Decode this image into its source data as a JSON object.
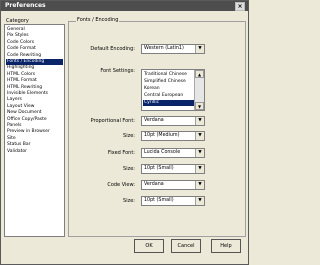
{
  "window": {
    "title": "Preferences",
    "close_glyph": "×"
  },
  "sidebar": {
    "label": "Category",
    "items": [
      {
        "label": "General"
      },
      {
        "label": "Pix Styles"
      },
      {
        "label": "Code Colors"
      },
      {
        "label": "Code Format"
      },
      {
        "label": "Code Rewriting"
      },
      {
        "label": "Fonts / Encoding",
        "selected": true
      },
      {
        "label": "Highlighting"
      },
      {
        "label": "HTML Colors"
      },
      {
        "label": "HTML Format"
      },
      {
        "label": "HTML Rewriting"
      },
      {
        "label": "Invisible Elements"
      },
      {
        "label": "Layers"
      },
      {
        "label": "Layout View"
      },
      {
        "label": "New Document"
      },
      {
        "label": "Office Copy/Paste"
      },
      {
        "label": "Panels"
      },
      {
        "label": "Preview in Browser"
      },
      {
        "label": "Site"
      },
      {
        "label": "Status Bar"
      },
      {
        "label": "Validator"
      }
    ]
  },
  "panel": {
    "title": "Fonts / Encoding",
    "default_encoding": {
      "label": "Default Encoding:",
      "value": "Western (Latin1)"
    },
    "font_settings": {
      "label": "Font Settings:",
      "items": [
        {
          "label": "Traditional Chinese"
        },
        {
          "label": "Simplified Chinese"
        },
        {
          "label": "Korean"
        },
        {
          "label": "Central European"
        },
        {
          "label": "Cyrillic",
          "selected": true
        }
      ]
    },
    "proportional_font": {
      "label": "Proportional Font:",
      "value": "Verdana"
    },
    "size1": {
      "label": "Size:",
      "value": "10pt (Medium)"
    },
    "fixed_font": {
      "label": "Fixed Font:",
      "value": "Lucida Console"
    },
    "size2": {
      "label": "Size:",
      "value": "10pt (Small)"
    },
    "code_view": {
      "label": "Code View:",
      "value": "Verdana"
    },
    "size3": {
      "label": "Size:",
      "value": "10pt (Small)"
    }
  },
  "buttons": {
    "ok": "OK",
    "cancel": "Cancel",
    "help": "Help"
  },
  "glyphs": {
    "dropdown": "▼",
    "scroll_up": "▲",
    "scroll_down": "▼"
  }
}
